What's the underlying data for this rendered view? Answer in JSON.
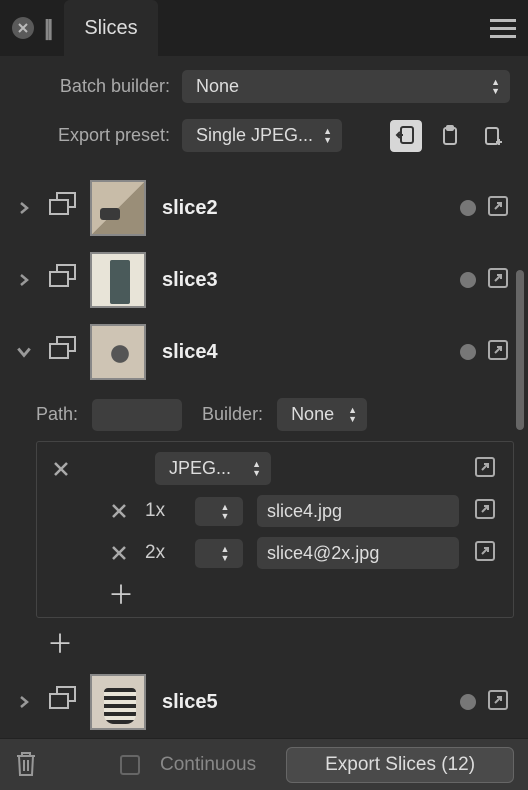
{
  "titlebar": {
    "tab_label": "Slices"
  },
  "options": {
    "batch_builder_label": "Batch builder:",
    "batch_builder_value": "None",
    "export_preset_label": "Export preset:",
    "export_preset_value": "Single JPEG..."
  },
  "slices": [
    {
      "name": "slice2",
      "expanded": false
    },
    {
      "name": "slice3",
      "expanded": false
    },
    {
      "name": "slice4",
      "expanded": true
    },
    {
      "name": "slice5",
      "expanded": false
    }
  ],
  "expanded_slice": {
    "path_label": "Path:",
    "path_value": "",
    "builder_label": "Builder:",
    "builder_value": "None",
    "format_value": "JPEG...",
    "variants": [
      {
        "scale": "1x",
        "filename": "slice4.jpg"
      },
      {
        "scale": "2x",
        "filename": "slice4@2x.jpg"
      }
    ]
  },
  "footer": {
    "continuous_label": "Continuous",
    "continuous_checked": false,
    "export_button": "Export Slices (12)"
  }
}
